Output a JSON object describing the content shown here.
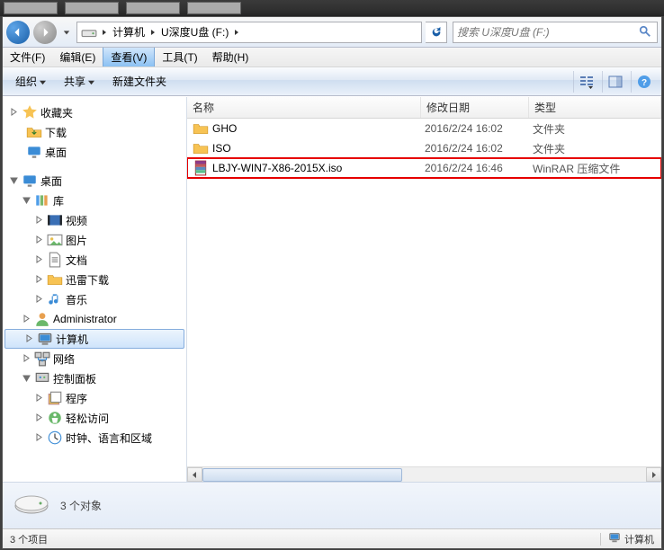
{
  "breadcrumb": {
    "seg1": "计算机",
    "seg2": "U深度U盘 (F:)"
  },
  "search": {
    "placeholder": "搜索 U深度U盘 (F:)"
  },
  "menu": {
    "file": "文件(F)",
    "edit": "编辑(E)",
    "view": "查看(V)",
    "tools": "工具(T)",
    "help": "帮助(H)"
  },
  "toolbar": {
    "organize": "组织",
    "share": "共享",
    "newfolder": "新建文件夹"
  },
  "columns": {
    "name": "名称",
    "date": "修改日期",
    "type": "类型"
  },
  "sidebar": {
    "favorites": "收藏夹",
    "downloads": "下载",
    "desktop": "桌面",
    "desktop2": "桌面",
    "libraries": "库",
    "videos": "视频",
    "pictures": "图片",
    "documents": "文档",
    "xunlei": "迅雷下载",
    "music": "音乐",
    "admin": "Administrator",
    "computer": "计算机",
    "network": "网络",
    "cpanel": "控制面板",
    "programs": "程序",
    "ease": "轻松访问",
    "clock": "时钟、语言和区域"
  },
  "files": [
    {
      "name": "GHO",
      "date": "2016/2/24 16:02",
      "type": "文件夹",
      "icon": "folder"
    },
    {
      "name": "ISO",
      "date": "2016/2/24 16:02",
      "type": "文件夹",
      "icon": "folder"
    },
    {
      "name": "LBJY-WIN7-X86-2015X.iso",
      "date": "2016/2/24 16:46",
      "type": "WinRAR 压缩文件",
      "icon": "rar",
      "highlight": true
    }
  ],
  "details": {
    "count": "3 个对象"
  },
  "status": {
    "items": "3 个项目",
    "computer": "计算机"
  }
}
